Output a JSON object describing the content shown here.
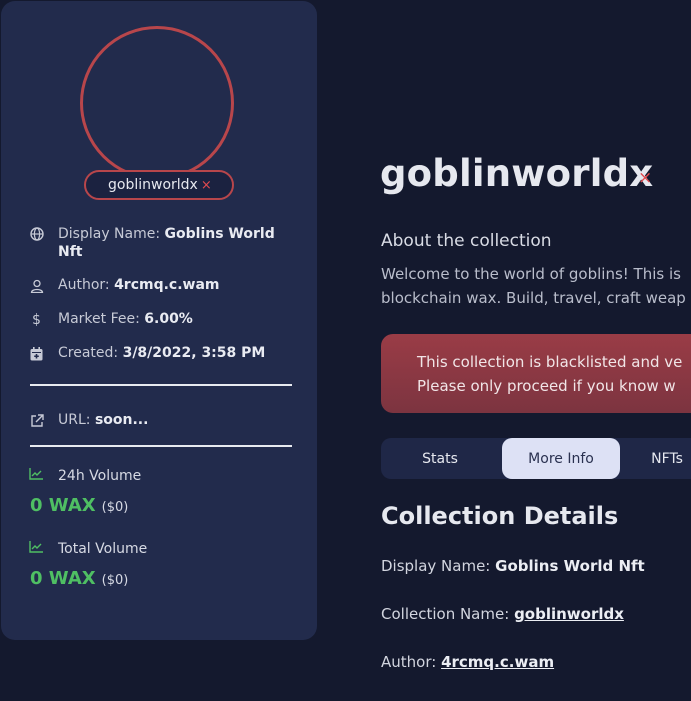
{
  "sidebar": {
    "collection_name": "goblinworldx",
    "remove_symbol": "×",
    "display_name": {
      "label": "Display Name:",
      "value": "Goblins World Nft"
    },
    "author": {
      "label": "Author:",
      "value": "4rcmq.c.wam"
    },
    "market_fee": {
      "label": "Market Fee:",
      "value": "6.00%"
    },
    "created": {
      "label": "Created:",
      "value": "3/8/2022, 3:58 PM"
    },
    "url": {
      "label": "URL:",
      "value": "soon..."
    },
    "volume_24h": {
      "label": "24h Volume",
      "wax": "0 WAX",
      "usd": "($0)"
    },
    "volume_total": {
      "label": "Total Volume",
      "wax": "0 WAX",
      "usd": "($0)"
    }
  },
  "main": {
    "title": "goblinworldx",
    "title_remove_symbol": "×",
    "about_heading": "About the collection",
    "about_line1": "Welcome to the world of goblins! This is",
    "about_line2": "blockchain wax. Build, travel, craft weap",
    "alert_line1": "This collection is blacklisted and ve",
    "alert_line2": "Please only proceed if you know w",
    "tabs": [
      {
        "label": "Stats"
      },
      {
        "label": "More Info"
      },
      {
        "label": "NFTs"
      }
    ],
    "section_title": "Collection Details",
    "details": {
      "display_name": {
        "label": "Display Name:",
        "value": "Goblins World Nft"
      },
      "collection_name": {
        "label": "Collection Name:",
        "value": "goblinworldx"
      },
      "author": {
        "label": "Author:",
        "value": "4rcmq.c.wam"
      }
    }
  },
  "colors": {
    "background": "#14192e",
    "card": "#222b4c",
    "accent_red": "#b8464b",
    "volume_green": "#4fbf63",
    "active_tab": "#dde1f5"
  },
  "icons": [
    "globe-icon",
    "user-icon",
    "dollar-icon",
    "calendar-icon",
    "external-link-icon",
    "trending-up-icon"
  ]
}
